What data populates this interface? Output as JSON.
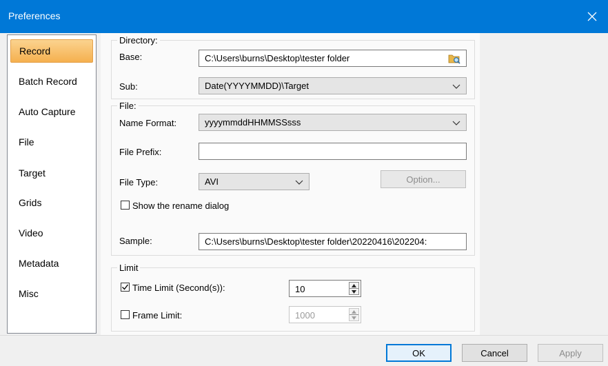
{
  "window": {
    "title": "Preferences"
  },
  "sidebar": {
    "items": [
      {
        "label": "Record",
        "active": true
      },
      {
        "label": "Batch Record"
      },
      {
        "label": "Auto Capture"
      },
      {
        "label": "File"
      },
      {
        "label": "Target"
      },
      {
        "label": "Grids"
      },
      {
        "label": "Video"
      },
      {
        "label": "Metadata"
      },
      {
        "label": "Misc"
      }
    ]
  },
  "directory": {
    "group_label": "Directory:",
    "base_label": "Base:",
    "base_value": "C:\\Users\\burns\\Desktop\\tester folder",
    "sub_label": "Sub:",
    "sub_value": "Date(YYYYMMDD)\\Target"
  },
  "file": {
    "group_label": "File:",
    "name_format_label": "Name Format:",
    "name_format_value": "yyyymmddHHMMSSsss",
    "prefix_label": "File Prefix:",
    "prefix_value": "",
    "type_label": "File Type:",
    "type_value": "AVI",
    "option_button": "Option...",
    "rename_dialog_label": "Show the rename dialog",
    "rename_dialog_checked": false
  },
  "sample": {
    "label": "Sample:",
    "value": "C:\\Users\\burns\\Desktop\\tester folder\\20220416\\202204:"
  },
  "limit": {
    "group_label": "Limit",
    "time_limit_label": "Time Limit (Second(s)):",
    "time_limit_checked": true,
    "time_limit_value": "10",
    "frame_limit_label": "Frame Limit:",
    "frame_limit_checked": false,
    "frame_limit_value": "1000"
  },
  "buttons": {
    "ok": "OK",
    "cancel": "Cancel",
    "apply": "Apply"
  },
  "colors": {
    "titlebar": "#0078d7",
    "selected_gradient_top": "#fbd38f",
    "selected_gradient_bottom": "#f5b04f"
  }
}
